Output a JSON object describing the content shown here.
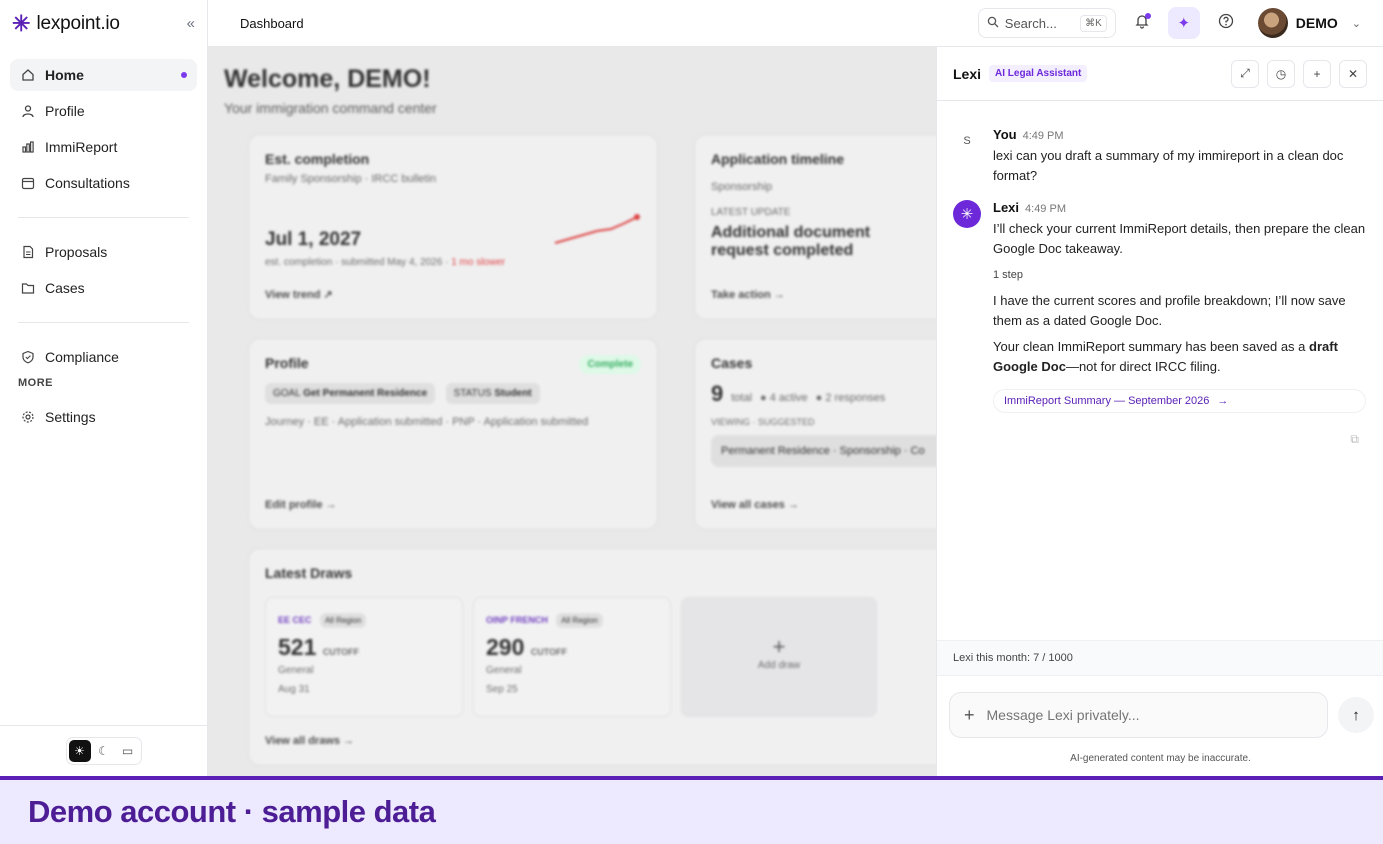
{
  "brand": {
    "name": "lexpoint.io",
    "logo_icon": "asterisk-icon"
  },
  "sidebar": {
    "items": [
      {
        "label": "Home",
        "icon": "home-icon",
        "active": true
      },
      {
        "label": "Profile",
        "icon": "user-icon"
      },
      {
        "label": "ImmiReport",
        "icon": "chart-icon"
      },
      {
        "label": "Consultations",
        "icon": "calendar-icon"
      },
      {
        "label": "Proposals",
        "icon": "document-icon"
      },
      {
        "label": "Cases",
        "icon": "folder-icon"
      },
      {
        "label": "Compliance",
        "icon": "shield-icon"
      },
      {
        "label": "Settings",
        "icon": "gear-icon"
      }
    ],
    "more_heading": "MORE"
  },
  "topbar": {
    "breadcrumb": "Dashboard",
    "search_placeholder": "Search...",
    "search_shortcut": "⌘K",
    "user_name": "DEMO"
  },
  "main": {
    "welcome": "Welcome, DEMO!",
    "subtitle": "Your immigration command center",
    "est_completion": {
      "title": "Est. completion",
      "subtitle": "Family Sponsorship · IRCC bulletin",
      "date": "Jul 1, 2027",
      "detail": "est. completion · submitted May 4, 2026 ·",
      "delta": "1 mo slower",
      "link": "View trend ↗"
    },
    "timeline": {
      "title": "Application timeline",
      "subtitle": "Sponsorship",
      "update_label": "LATEST UPDATE",
      "update_line1": "Additional document",
      "update_line2": "request completed",
      "link": "Take action →"
    },
    "profile": {
      "title": "Profile",
      "badge": "Complete",
      "goal_label": "GOAL",
      "goal_value": "Get Permanent Residence",
      "status_label": "STATUS",
      "status_value": "Student",
      "journey": "Journey · EE · Application submitted · PNP · Application submitted",
      "link": "Edit profile →"
    },
    "cases": {
      "title": "Cases",
      "total": "9",
      "total_label": "total",
      "active": "4 active",
      "responses": "2 responses",
      "viewing": "VIEWING · SUGGESTED",
      "row": "Permanent Residence · Sponsorship · Co",
      "link": "View all cases →"
    },
    "draws": {
      "title": "Latest Draws",
      "items": [
        {
          "tag": "EE CEC",
          "region": "All Region",
          "score": "521",
          "unit": "CUTOFF",
          "type": "General",
          "date": "Aug 31"
        },
        {
          "tag": "OINP FRENCH",
          "region": "All Region",
          "score": "290",
          "unit": "CUTOFF",
          "type": "General",
          "date": "Sep 25"
        }
      ],
      "add_label": "Add draw",
      "link": "View all draws →"
    }
  },
  "lexi": {
    "title": "Lexi",
    "tag": "AI Legal Assistant",
    "user_initial": "S",
    "user_name": "You",
    "user_time": "4:49 PM",
    "user_message": "lexi can you draft a summary of my immireport in a clean doc format?",
    "bot_name": "Lexi",
    "bot_time": "4:49 PM",
    "bot_message_1": "I’ll check your current ImmiReport details, then prepare the clean Google Doc takeaway.",
    "steps": "1 step",
    "bot_message_2": "I have the current scores and profile breakdown; I’ll now save them as a dated Google Doc.",
    "bot_message_3_pre": "Your clean ImmiReport summary has been saved as a",
    "bot_message_3_bold": "draft Google Doc",
    "bot_message_3_post": "—not for direct IRCC filing.",
    "doc_link": "ImmiReport Summary — September 2026",
    "usage": "Lexi this month: 7 / 1000",
    "input_placeholder": "Message Lexi privately...",
    "disclaimer": "AI-generated content may be inaccurate."
  },
  "banner": {
    "text": "Demo account · sample data"
  },
  "colors": {
    "accent": "#5b21b6",
    "banner_bg": "#ede9fe"
  }
}
